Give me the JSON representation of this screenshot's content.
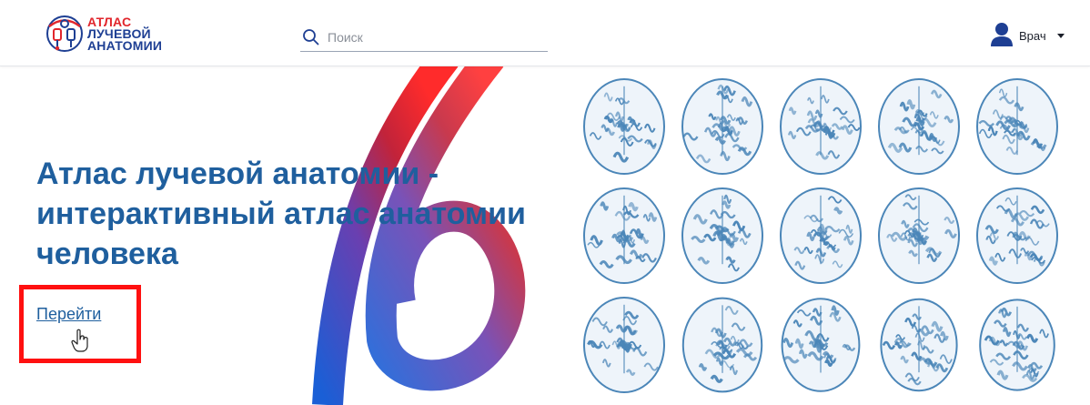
{
  "header": {
    "logo": {
      "line1": "АТЛАС",
      "line2": "ЛУЧЕВОЙ",
      "line3": "АНАТОМИИ",
      "icon": "anatomy-logo-icon"
    },
    "search": {
      "placeholder": "Поиск",
      "value": "",
      "icon": "search-icon"
    },
    "user": {
      "label": "Врач",
      "icon": "user-icon",
      "caret_icon": "caret-down-icon"
    }
  },
  "hero": {
    "headline": "Атлас лучевой анатомии - интерактивный атлас анатомии человека",
    "cta_label": "Перейти",
    "image": "brain-mri-slices"
  },
  "colors": {
    "brand_blue": "#1e3f93",
    "brand_red": "#e1262c",
    "headline": "#1f5f9e",
    "highlight": "#ff1010",
    "mri": "#4b86b8"
  }
}
